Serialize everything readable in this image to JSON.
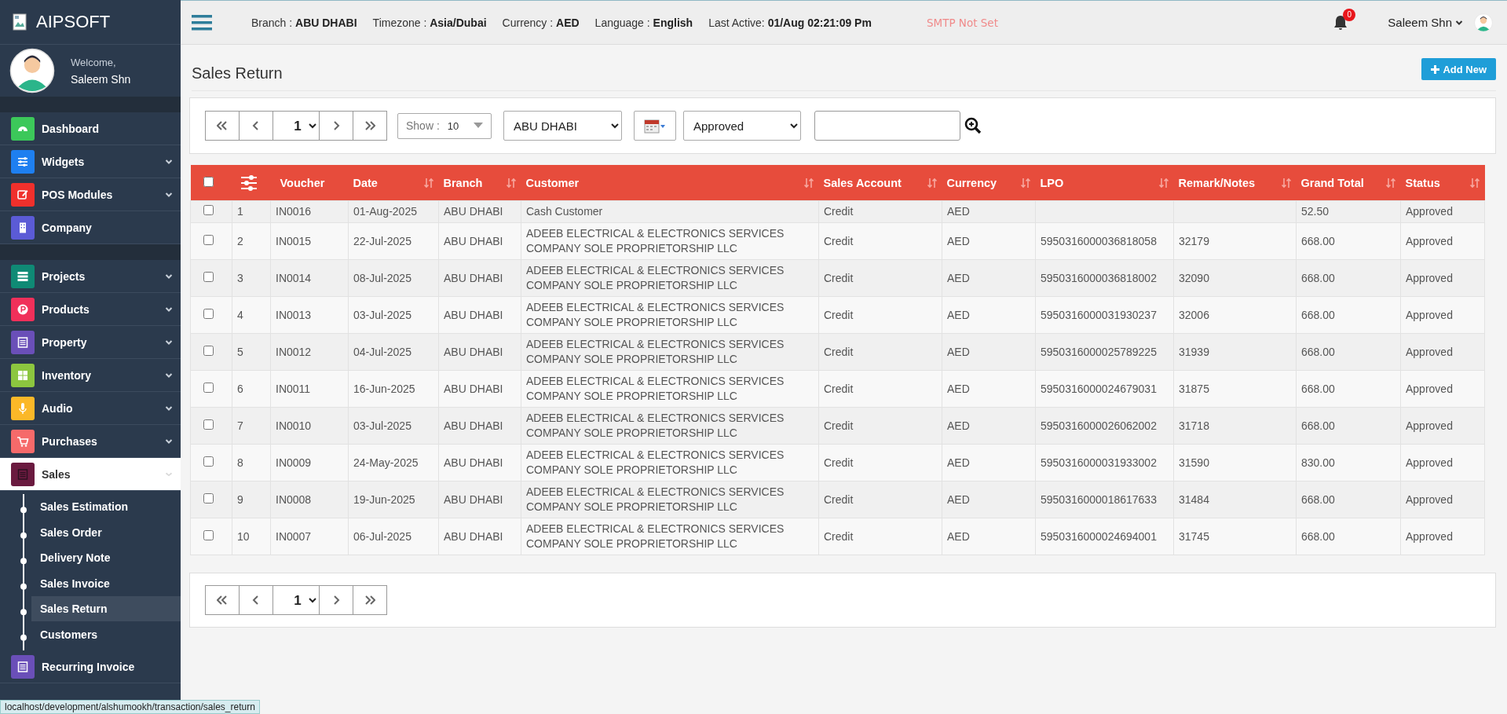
{
  "sidebar": {
    "logo": "AIPSOFT",
    "welcome": "Welcome,",
    "user": "Saleem Shn",
    "groups": [
      {
        "items": [
          {
            "label": "Dashboard",
            "color": "#3cc85a",
            "has_submenu": false,
            "selected": false
          },
          {
            "label": "Widgets",
            "color": "#1e7ff0",
            "has_submenu": true,
            "selected": false
          },
          {
            "label": "POS Modules",
            "color": "#f0302c",
            "has_submenu": true,
            "selected": false
          },
          {
            "label": "Company",
            "color": "#5b5bd6",
            "has_submenu": false,
            "selected": false
          }
        ]
      },
      {
        "items": [
          {
            "label": "Projects",
            "color": "#0f8a75",
            "has_submenu": true,
            "selected": false
          },
          {
            "label": "Products",
            "color": "#f0305a",
            "has_submenu": true,
            "selected": false
          },
          {
            "label": "Property",
            "color": "#6a4fb8",
            "has_submenu": true,
            "selected": false
          },
          {
            "label": "Inventory",
            "color": "#8cc63f",
            "has_submenu": true,
            "selected": false
          },
          {
            "label": "Audio",
            "color": "#fbb828",
            "has_submenu": true,
            "selected": false
          },
          {
            "label": "Purchases",
            "color": "#f66a6a",
            "has_submenu": true,
            "selected": false
          },
          {
            "label": "Sales",
            "color": "#6a1a3f",
            "has_submenu": true,
            "selected": true,
            "expanded": true,
            "children": [
              {
                "label": "Sales Estimation",
                "selected": false
              },
              {
                "label": "Sales Order",
                "selected": false
              },
              {
                "label": "Delivery Note",
                "selected": false
              },
              {
                "label": "Sales Invoice",
                "selected": false
              },
              {
                "label": "Sales Return",
                "selected": true
              },
              {
                "label": "Customers",
                "selected": false
              }
            ]
          },
          {
            "label": "Recurring Invoice",
            "color": "#6a4fb8",
            "has_submenu": false,
            "selected": false
          }
        ]
      }
    ]
  },
  "topbar": {
    "info": [
      {
        "label": "Branch :",
        "value": "ABU DHABI"
      },
      {
        "label": "Timezone :",
        "value": "Asia/Dubai"
      },
      {
        "label": "Currency :",
        "value": "AED"
      },
      {
        "label": "Language :",
        "value": "English"
      },
      {
        "label": "Last Active:",
        "value": "01/Aug 02:21:09 Pm"
      }
    ],
    "smtp_warning": "SMTP Not Set",
    "notification_count": "0",
    "user": "Saleem Shn"
  },
  "page": {
    "title": "Sales Return",
    "add_button": "Add New"
  },
  "filters": {
    "page": "1",
    "show_label": "Show :",
    "show_value": "10",
    "branch": "ABU DHABI",
    "status": "Approved"
  },
  "table": {
    "select_all_checked": false,
    "columns": [
      {
        "label": "Voucher",
        "sortable": false
      },
      {
        "label": "Date",
        "sortable": true
      },
      {
        "label": "Branch",
        "sortable": true
      },
      {
        "label": "Customer",
        "sortable": true
      },
      {
        "label": "Sales Account",
        "sortable": true
      },
      {
        "label": "Currency",
        "sortable": true
      },
      {
        "label": "LPO",
        "sortable": true
      },
      {
        "label": "Remark/Notes",
        "sortable": true
      },
      {
        "label": "Grand Total",
        "sortable": true
      },
      {
        "label": "Status",
        "sortable": true
      }
    ],
    "rows": [
      {
        "checked": false,
        "no": "1",
        "cells": [
          "IN0016",
          "01-Aug-2025",
          "ABU DHABI",
          "Cash Customer",
          "Credit",
          "AED",
          "",
          "",
          "52.50",
          "Approved"
        ]
      },
      {
        "checked": false,
        "no": "2",
        "cells": [
          "IN0015",
          "22-Jul-2025",
          "ABU DHABI",
          "ADEEB ELECTRICAL & ELECTRONICS SERVICES COMPANY SOLE PROPRIETORSHIP LLC",
          "Credit",
          "AED",
          "5950316000036818058",
          "32179",
          "668.00",
          "Approved"
        ]
      },
      {
        "checked": false,
        "no": "3",
        "cells": [
          "IN0014",
          "08-Jul-2025",
          "ABU DHABI",
          "ADEEB ELECTRICAL & ELECTRONICS SERVICES COMPANY SOLE PROPRIETORSHIP LLC",
          "Credit",
          "AED",
          "5950316000036818002",
          "32090",
          "668.00",
          "Approved"
        ]
      },
      {
        "checked": false,
        "no": "4",
        "cells": [
          "IN0013",
          "03-Jul-2025",
          "ABU DHABI",
          "ADEEB ELECTRICAL & ELECTRONICS SERVICES COMPANY SOLE PROPRIETORSHIP LLC",
          "Credit",
          "AED",
          "5950316000031930237",
          "32006",
          "668.00",
          "Approved"
        ]
      },
      {
        "checked": false,
        "no": "5",
        "cells": [
          "IN0012",
          "04-Jul-2025",
          "ABU DHABI",
          "ADEEB ELECTRICAL & ELECTRONICS SERVICES COMPANY SOLE PROPRIETORSHIP LLC",
          "Credit",
          "AED",
          "5950316000025789225",
          "31939",
          "668.00",
          "Approved"
        ]
      },
      {
        "checked": false,
        "no": "6",
        "cells": [
          "IN0011",
          "16-Jun-2025",
          "ABU DHABI",
          "ADEEB ELECTRICAL & ELECTRONICS SERVICES COMPANY SOLE PROPRIETORSHIP LLC",
          "Credit",
          "AED",
          "5950316000024679031",
          "31875",
          "668.00",
          "Approved"
        ]
      },
      {
        "checked": false,
        "no": "7",
        "cells": [
          "IN0010",
          "03-Jul-2025",
          "ABU DHABI",
          "ADEEB ELECTRICAL & ELECTRONICS SERVICES COMPANY SOLE PROPRIETORSHIP LLC",
          "Credit",
          "AED",
          "5950316000026062002",
          "31718",
          "668.00",
          "Approved"
        ]
      },
      {
        "checked": false,
        "no": "8",
        "cells": [
          "IN0009",
          "24-May-2025",
          "ABU DHABI",
          "ADEEB ELECTRICAL & ELECTRONICS SERVICES COMPANY SOLE PROPRIETORSHIP LLC",
          "Credit",
          "AED",
          "5950316000031933002",
          "31590",
          "830.00",
          "Approved"
        ]
      },
      {
        "checked": false,
        "no": "9",
        "cells": [
          "IN0008",
          "19-Jun-2025",
          "ABU DHABI",
          "ADEEB ELECTRICAL & ELECTRONICS SERVICES COMPANY SOLE PROPRIETORSHIP LLC",
          "Credit",
          "AED",
          "5950316000018617633",
          "31484",
          "668.00",
          "Approved"
        ]
      },
      {
        "checked": false,
        "no": "10",
        "cells": [
          "IN0007",
          "06-Jul-2025",
          "ABU DHABI",
          "ADEEB ELECTRICAL & ELECTRONICS SERVICES COMPANY SOLE PROPRIETORSHIP LLC",
          "Credit",
          "AED",
          "5950316000024694001",
          "31745",
          "668.00",
          "Approved"
        ]
      }
    ]
  },
  "bottom_pager": {
    "page": "1"
  },
  "status_bar": "localhost/development/alshumookh/transaction/sales_return"
}
